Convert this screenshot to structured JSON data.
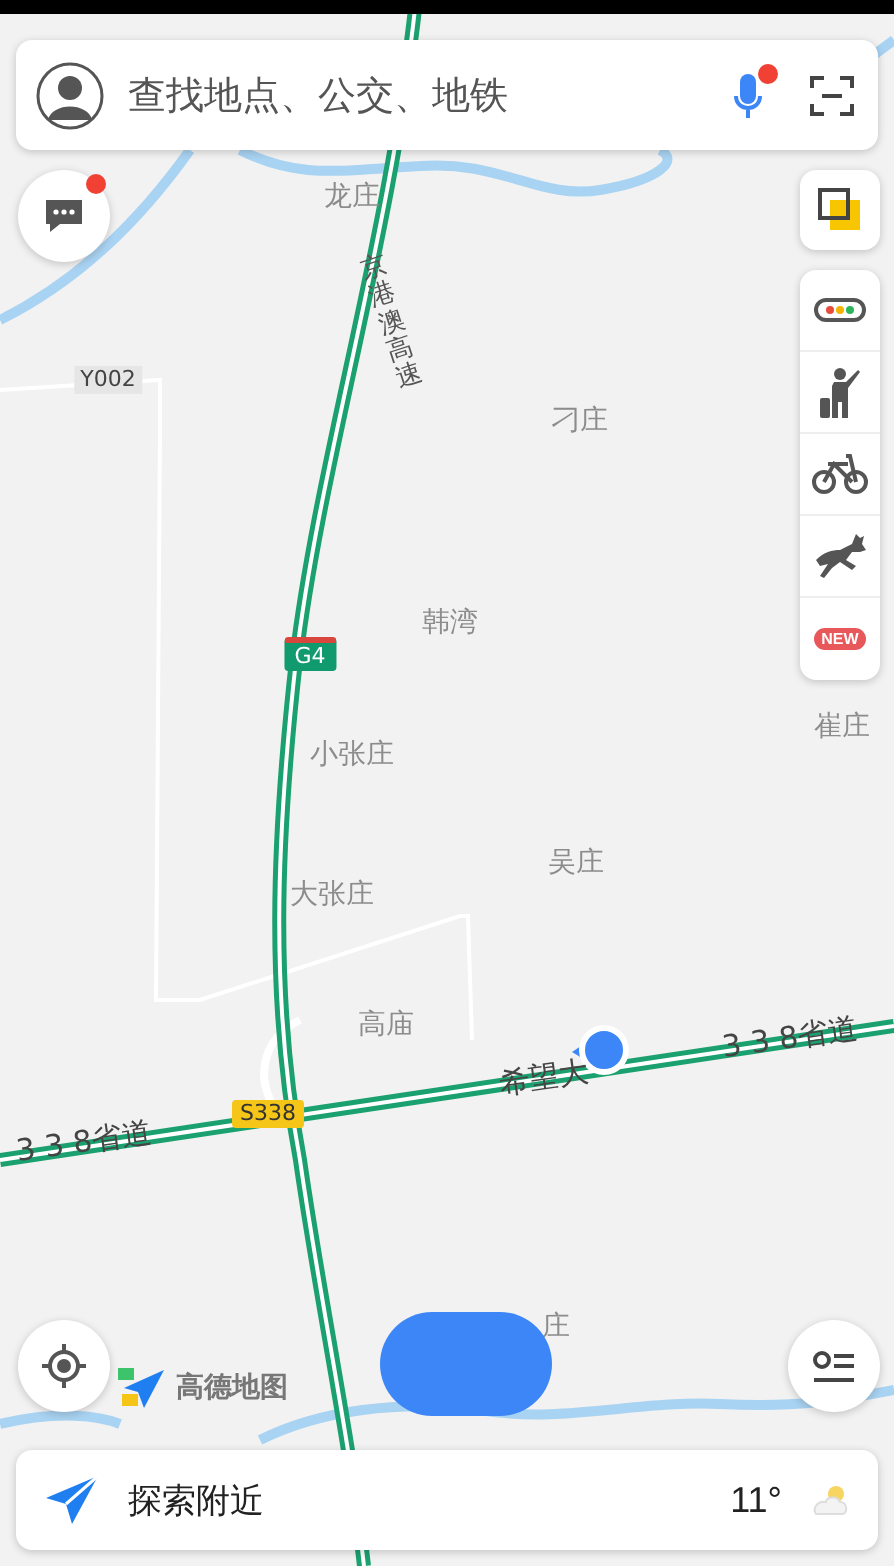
{
  "search": {
    "placeholder": "查找地点、公交、地铁",
    "voice_badge": true
  },
  "messages": {
    "badge": true
  },
  "tools": [
    {
      "kind": "traffic"
    },
    {
      "kind": "taxi"
    },
    {
      "kind": "bike"
    },
    {
      "kind": "train"
    },
    {
      "kind": "new",
      "label": "NEW"
    }
  ],
  "map_labels": [
    {
      "kind": "place",
      "text": "龙庄"
    },
    {
      "kind": "highway",
      "text": "京港澳高速"
    },
    {
      "kind": "county",
      "text": "Y002"
    },
    {
      "kind": "place",
      "text": "刁庄"
    },
    {
      "kind": "national",
      "text": "G4"
    },
    {
      "kind": "place",
      "text": "韩湾"
    },
    {
      "kind": "place",
      "text": "小张庄"
    },
    {
      "kind": "place",
      "text": "崔庄"
    },
    {
      "kind": "place",
      "text": "大张庄"
    },
    {
      "kind": "place",
      "text": "吴庄"
    },
    {
      "kind": "place",
      "text": "高庙"
    },
    {
      "kind": "road",
      "text": "希望大"
    },
    {
      "kind": "road",
      "text": "3 3 8省道"
    },
    {
      "kind": "road",
      "text": "3 3 8省道"
    },
    {
      "kind": "provincial",
      "text": "S338"
    },
    {
      "kind": "place",
      "text": "庄"
    }
  ],
  "logo": {
    "text": "高德地图"
  },
  "bottom": {
    "title": "探索附近",
    "temperature": "11°"
  }
}
